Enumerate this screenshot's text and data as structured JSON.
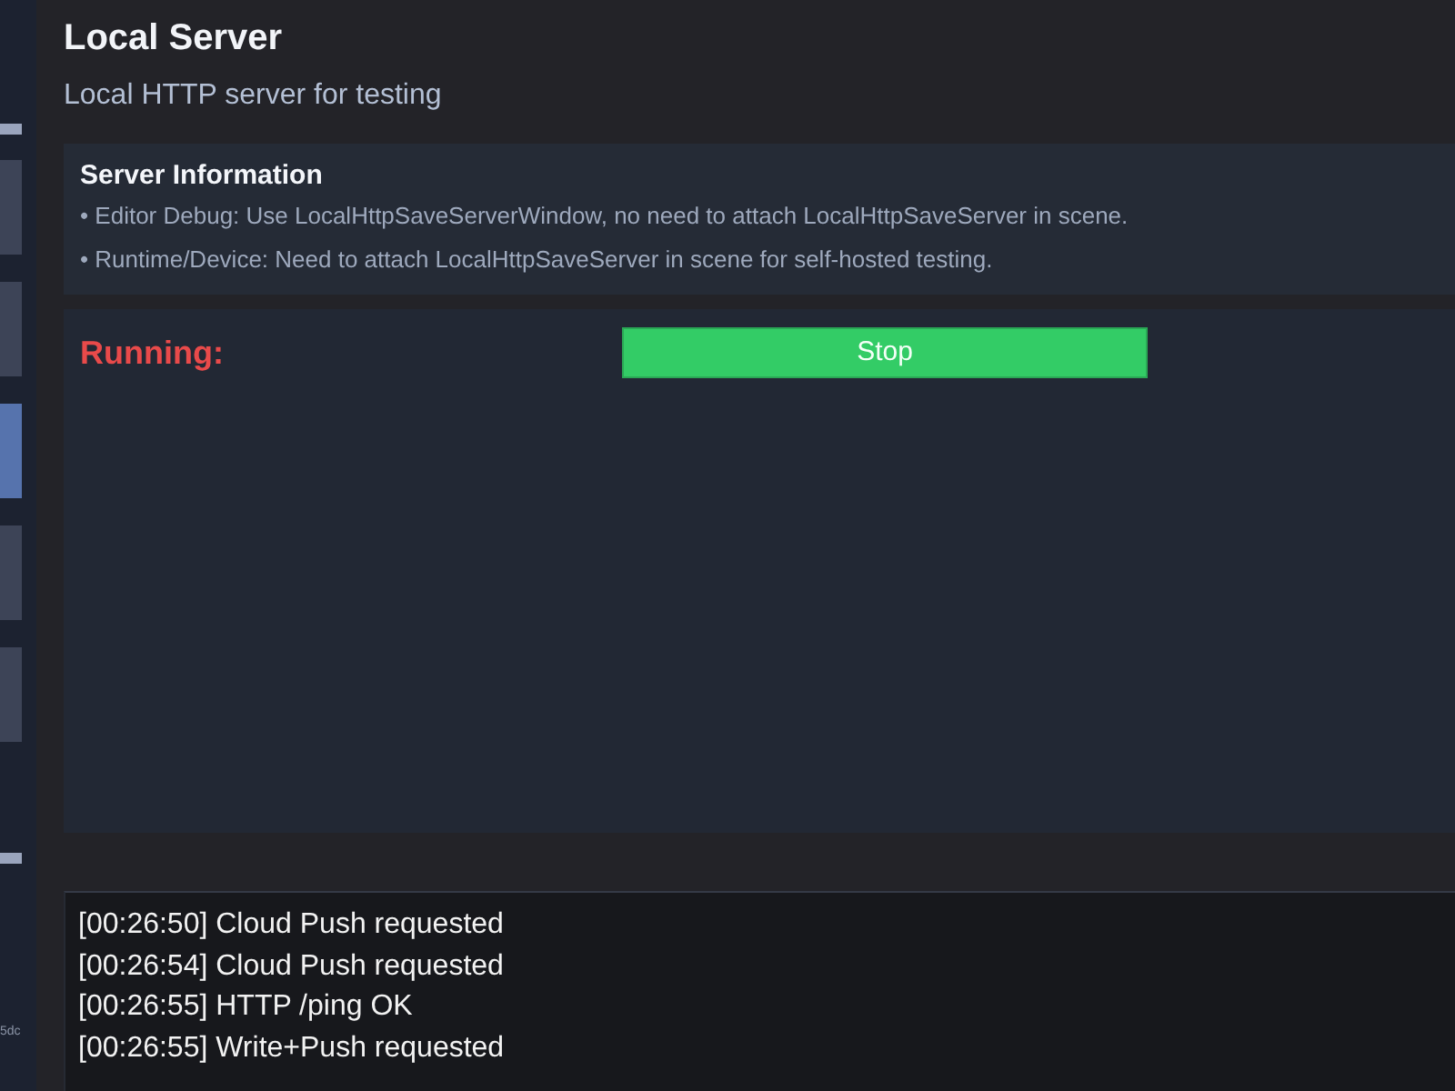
{
  "sidebar": {
    "tiles": [
      {
        "selected": false
      },
      {
        "selected": false
      },
      {
        "selected": true
      },
      {
        "selected": false
      },
      {
        "selected": false
      }
    ],
    "footer_text": "5dc"
  },
  "header": {
    "title": "Local Server",
    "subtitle": "Local HTTP server for testing"
  },
  "info_card": {
    "title": "Server Information",
    "bullets": [
      "• Editor Debug: Use LocalHttpSaveServerWindow, no need to attach LocalHttpSaveServer in scene.",
      "• Runtime/Device: Need to attach LocalHttpSaveServer in scene for self-hosted testing."
    ]
  },
  "status_panel": {
    "status_label": "Running:",
    "button": "Stop"
  },
  "log": {
    "lines": [
      "[00:26:50] Cloud Push requested",
      "[00:26:54] Cloud Push requested",
      "[00:26:55] HTTP /ping OK",
      "[00:26:55] Write+Push requested"
    ]
  }
}
